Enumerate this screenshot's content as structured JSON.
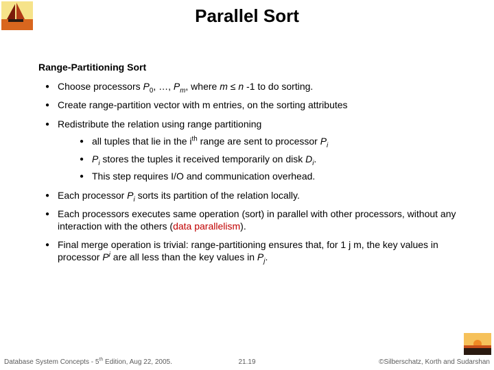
{
  "title": "Parallel Sort",
  "subhead": "Range-Partitioning Sort",
  "bullets": {
    "b1_pre": "Choose processors ",
    "b1_p0": "P",
    "b1_zero": "0",
    "b1_mid1": ", …, ",
    "b1_pm": "P",
    "b1_m": "m",
    "b1_mid2": ", where ",
    "b1_mvar": "m",
    "b1_le": " ≤ ",
    "b1_nvar": "n",
    "b1_post": " -1 to do sorting.",
    "b2": "Create range-partition vector with m entries, on the sorting attributes",
    "b3": "Redistribute the relation using range partitioning",
    "b3a_pre": "all tuples that lie in the i",
    "b3a_th": "th",
    "b3a_mid": " range are sent to processor ",
    "b3a_P": "P",
    "b3a_i": "i",
    "b3b_P": "P",
    "b3b_i": "i",
    "b3b_mid": " stores the tuples it received temporarily on disk ",
    "b3b_D": "D",
    "b3b_i2": "i",
    "b3b_dot": ".",
    "b3c": "This step requires I/O and communication overhead.",
    "b4_pre": "Each processor ",
    "b4_P": "P",
    "b4_i": "i",
    "b4_post": " sorts its partition of the relation locally.",
    "b5_pre": "Each processors executes same operation (sort) in parallel with other processors, without any interaction with the others  (",
    "b5_red": "data parallelism",
    "b5_post": ").",
    "b6_pre": "Final merge operation is trivial: range-partitioning ensures that, for 1  j  m, the key values in processor ",
    "b6_Pi": "P",
    "b6_i": "i",
    "b6_mid": " are all less than the key values in ",
    "b6_Pj": "P",
    "b6_j": "j",
    "b6_dot": "."
  },
  "footer": {
    "left_pre": "Database System Concepts - 5",
    "left_th": "th",
    "left_post": " Edition, Aug 22,  2005.",
    "center": "21.19",
    "right": "©Silberschatz, Korth and Sudarshan"
  }
}
